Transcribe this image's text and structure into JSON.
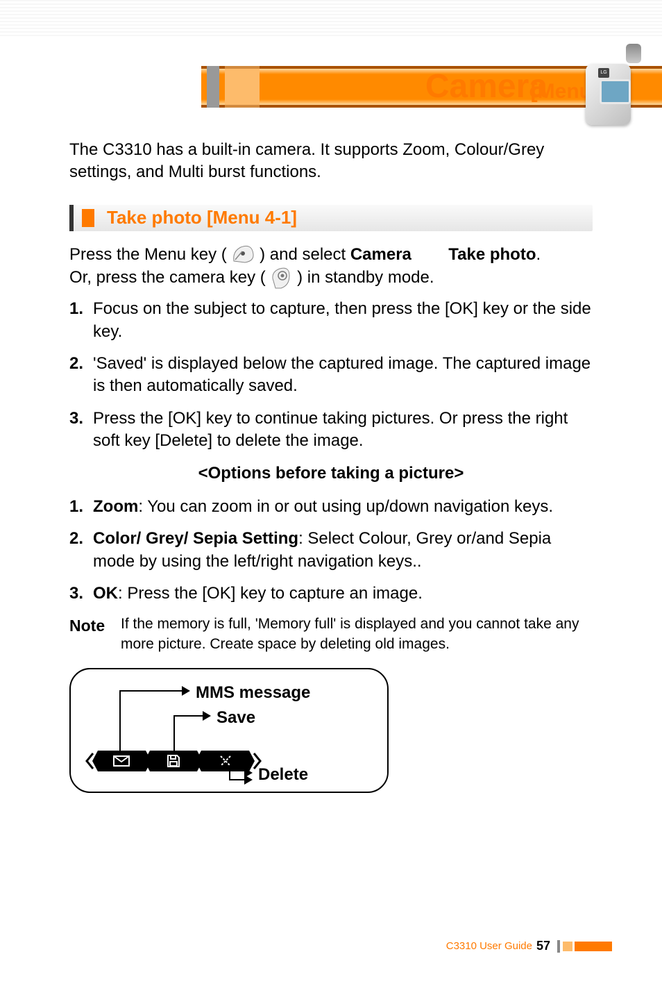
{
  "header": {
    "title": "Camera",
    "subtitle": "[Menu 4]",
    "phone_logo": "LG"
  },
  "intro": "The C3310 has a built-in camera. It supports Zoom, Colour/Grey settings, and Multi burst functions.",
  "section": {
    "title": "Take photo [Menu 4-1]"
  },
  "lead": {
    "part1": "Press the Menu key (",
    "part2": ") and select ",
    "camera_word": "Camera",
    "arrow_gap": "   →   ",
    "take_photo": "Take photo",
    "period": ".",
    "line2a": "Or, press the camera key (",
    "line2b": ") in standby mode."
  },
  "steps": [
    "Focus on the subject to capture, then press the [OK] key or the side key.",
    "'Saved' is displayed below the captured image. The captured image is then automatically saved.",
    "Press the [OK] key to continue taking pictures. Or press the right soft key [Delete] to delete the image."
  ],
  "options_title": "<Options before taking a picture>",
  "options": [
    {
      "label": "Zoom",
      "text": ": You can zoom in or out using up/down navigation keys."
    },
    {
      "label": "Color/ Grey/ Sepia Setting",
      "text": ": Select Colour, Grey or/and Sepia mode by using the left/right navigation keys.."
    },
    {
      "label": "OK",
      "text": ": Press the [OK] key to capture an image."
    }
  ],
  "note": {
    "label": "Note",
    "text": "If the memory is full, 'Memory full' is displayed and you cannot take any more picture. Create space by deleting old images."
  },
  "diagram": {
    "mms": "MMS message",
    "save": "Save",
    "delete": "Delete"
  },
  "footer": {
    "guide": "C3310 User Guide",
    "page": "57"
  },
  "nums": {
    "n1": "1.",
    "n2": "2.",
    "n3": "3."
  }
}
